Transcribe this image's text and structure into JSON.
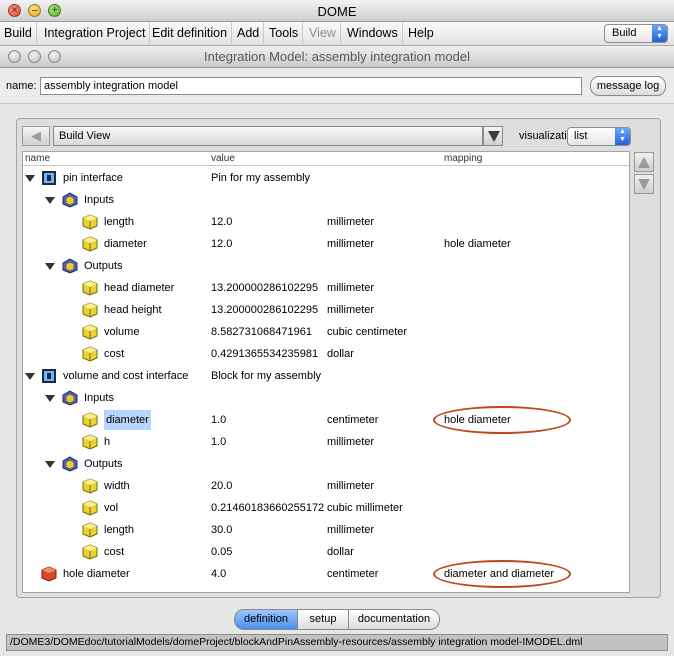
{
  "app": {
    "title": "DOME"
  },
  "menubar": {
    "items": [
      "Build",
      "Integration Project",
      "Edit definition",
      "Add",
      "Tools",
      "View",
      "Windows",
      "Help"
    ],
    "mode_select": "Build"
  },
  "inner_window": {
    "title": "Integration Model: assembly integration model",
    "name_label": "name:",
    "name_value": "assembly integration model",
    "message_log": "message log"
  },
  "view": {
    "current": "Build View",
    "visualization_label": "visualization",
    "visualization_value": "list"
  },
  "columns": {
    "name": "name",
    "value": "value",
    "mapping": "mapping"
  },
  "rows": [
    {
      "level": 0,
      "kind": "interface",
      "expand": true,
      "name": "pin interface",
      "value": "Pin  for my assembly",
      "unit": "",
      "mapping": ""
    },
    {
      "level": 1,
      "kind": "group",
      "expand": true,
      "name": "Inputs",
      "value": "",
      "unit": "",
      "mapping": ""
    },
    {
      "level": 2,
      "kind": "param",
      "expand": false,
      "name": "length",
      "value": "12.0",
      "unit": "millimeter",
      "mapping": ""
    },
    {
      "level": 2,
      "kind": "param",
      "expand": false,
      "name": "diameter",
      "value": "12.0",
      "unit": "millimeter",
      "mapping": "hole diameter"
    },
    {
      "level": 1,
      "kind": "group",
      "expand": true,
      "name": "Outputs",
      "value": "",
      "unit": "",
      "mapping": ""
    },
    {
      "level": 2,
      "kind": "param",
      "expand": false,
      "name": "head diameter",
      "value": "13.200000286102295",
      "unit": "millimeter",
      "mapping": ""
    },
    {
      "level": 2,
      "kind": "param",
      "expand": false,
      "name": "head height",
      "value": "13.200000286102295",
      "unit": "millimeter",
      "mapping": ""
    },
    {
      "level": 2,
      "kind": "param",
      "expand": false,
      "name": "volume",
      "value": "8.582731068471961",
      "unit": "cubic centimeter",
      "mapping": ""
    },
    {
      "level": 2,
      "kind": "param",
      "expand": false,
      "name": "cost",
      "value": "0.4291365534235981",
      "unit": "dollar",
      "mapping": ""
    },
    {
      "level": 0,
      "kind": "interface",
      "expand": true,
      "name": "volume and cost interface",
      "value": "Block for my assembly",
      "unit": "",
      "mapping": ""
    },
    {
      "level": 1,
      "kind": "group",
      "expand": true,
      "name": "Inputs",
      "value": "",
      "unit": "",
      "mapping": ""
    },
    {
      "level": 2,
      "kind": "param",
      "expand": false,
      "name": "diameter",
      "value": "1.0",
      "unit": "centimeter",
      "mapping": "hole diameter",
      "selected": true
    },
    {
      "level": 2,
      "kind": "param",
      "expand": false,
      "name": "h",
      "value": "1.0",
      "unit": "millimeter",
      "mapping": ""
    },
    {
      "level": 1,
      "kind": "group",
      "expand": true,
      "name": "Outputs",
      "value": "",
      "unit": "",
      "mapping": ""
    },
    {
      "level": 2,
      "kind": "param",
      "expand": false,
      "name": "width",
      "value": "20.0",
      "unit": "millimeter",
      "mapping": ""
    },
    {
      "level": 2,
      "kind": "param",
      "expand": false,
      "name": "vol",
      "value": "0.21460183660255172",
      "unit": "cubic millimeter",
      "mapping": ""
    },
    {
      "level": 2,
      "kind": "param",
      "expand": false,
      "name": "length",
      "value": "30.0",
      "unit": "millimeter",
      "mapping": ""
    },
    {
      "level": 2,
      "kind": "param",
      "expand": false,
      "name": "cost",
      "value": "0.05",
      "unit": "dollar",
      "mapping": ""
    },
    {
      "level": 0,
      "kind": "relation",
      "expand": false,
      "name": "hole diameter",
      "value": "4.0",
      "unit": "centimeter",
      "mapping": "diameter and diameter"
    }
  ],
  "tabs": [
    "definition",
    "setup",
    "documentation"
  ],
  "active_tab": "definition",
  "status_path": "/DOME3/DOMEdoc/tutorialModels/domeProject/blockAndPinAssembly-resources/assembly integration model-IMODEL.dml",
  "colors": {
    "highlight_ellipse": "#c0461e",
    "selection": "#b5d5ff",
    "active_tab": "#4c8de8"
  }
}
